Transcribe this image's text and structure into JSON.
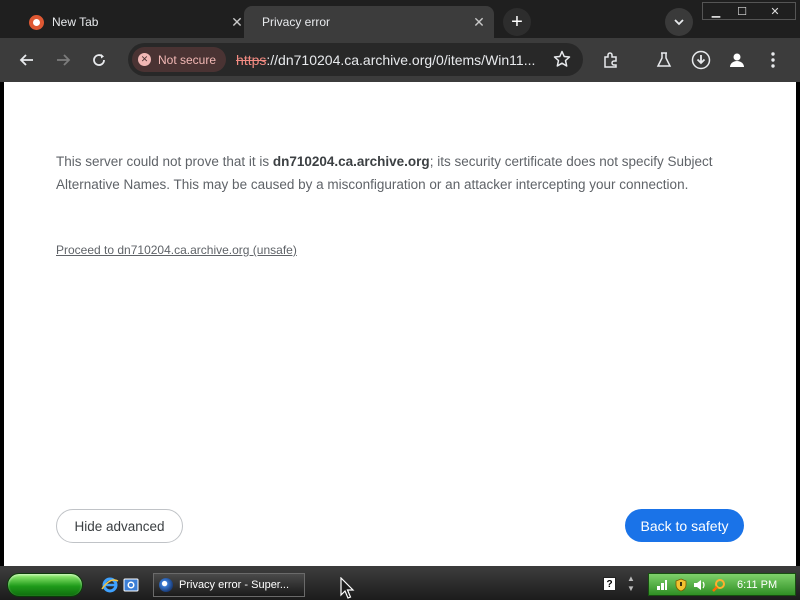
{
  "tabs": [
    {
      "title": "New Tab",
      "favicon": "duckduckgo-icon",
      "active": false
    },
    {
      "title": "Privacy error",
      "favicon": "",
      "active": true
    }
  ],
  "omnibox": {
    "security_chip": "Not secure",
    "url_scheme": "https",
    "url_rest": "://dn710204.ca.archive.org/0/items/Win11..."
  },
  "page": {
    "message_before": "This server could not prove that it is ",
    "message_domain": "dn710204.ca.archive.org",
    "message_after": "; its security certificate does not specify Subject Alternative Names. This may be caused by a misconfiguration or an attacker intercepting your connection.",
    "proceed_link": "Proceed to dn710204.ca.archive.org (unsafe)",
    "hide_advanced_label": "Hide advanced",
    "back_to_safety_label": "Back to safety"
  },
  "taskbar": {
    "task_label": "Privacy error - Super...",
    "clock": "6:11 PM",
    "help_glyph": "?"
  },
  "colors": {
    "accent": "#1a73e8",
    "danger": "#f28b82",
    "chrome_dark": "#3c3c3c"
  }
}
